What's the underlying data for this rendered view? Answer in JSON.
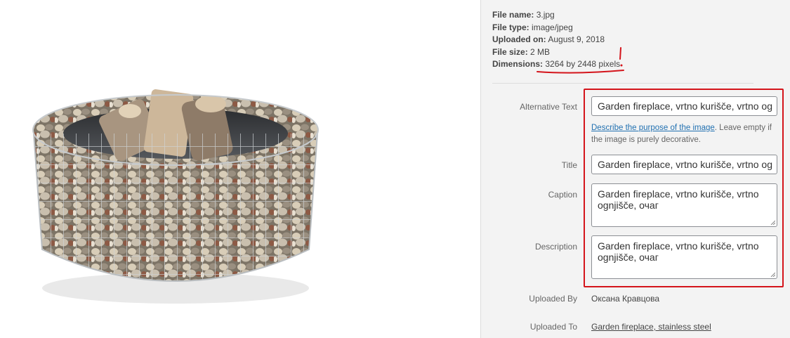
{
  "details": {
    "file_name_label": "File name:",
    "file_name": "3.jpg",
    "file_type_label": "File type:",
    "file_type": "image/jpeg",
    "uploaded_on_label": "Uploaded on:",
    "uploaded_on": "August 9, 2018",
    "file_size_label": "File size:",
    "file_size": "2 MB",
    "dimensions_label": "Dimensions:",
    "dimensions": "3264 by 2448 pixels"
  },
  "fields": {
    "alt_label": "Alternative Text",
    "alt_value": "Garden fireplace, vrtno kurišče, vrtno og",
    "alt_help_link": "Describe the purpose of the image",
    "alt_help_text": ". Leave empty if the image is purely decorative.",
    "title_label": "Title",
    "title_value": "Garden fireplace,  vrtno kurišče, vrtno og",
    "caption_label": "Caption",
    "caption_value": "Garden fireplace,  vrtno kurišče, vrtno ognjišče, очаг",
    "description_label": "Description",
    "description_value": "Garden fireplace,  vrtno kurišče, vrtno ognjišče, очаг"
  },
  "meta": {
    "uploaded_by_label": "Uploaded By",
    "uploaded_by": "Оксана Кравцова",
    "uploaded_to_label": "Uploaded To",
    "uploaded_to": "Garden fireplace, stainless steel"
  },
  "colors": {
    "highlight": "#d4141b",
    "link": "#2271b1"
  }
}
